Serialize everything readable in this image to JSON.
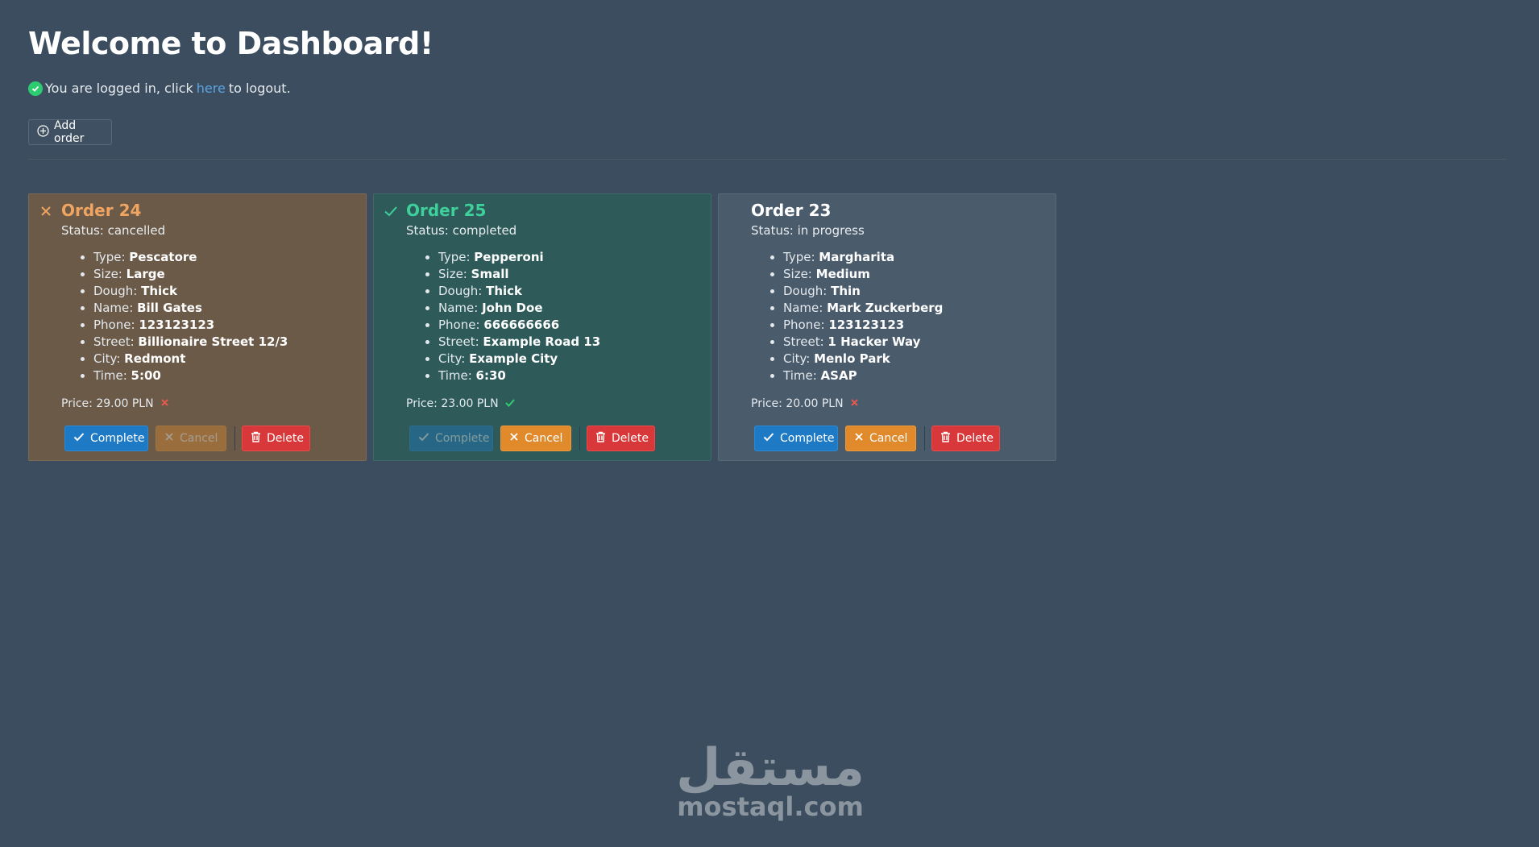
{
  "page": {
    "title": "Welcome to Dashboard!"
  },
  "login": {
    "prefix": "You are logged in, click",
    "link": "here",
    "suffix": "to logout."
  },
  "toolbar": {
    "add_label": "Add order"
  },
  "orders": [
    {
      "title": "Order 24",
      "status": "Status: cancelled",
      "fields": [
        {
          "label": "Type:",
          "value": "Pescatore"
        },
        {
          "label": "Size:",
          "value": "Large"
        },
        {
          "label": "Dough:",
          "value": "Thick"
        },
        {
          "label": "Name:",
          "value": "Bill Gates"
        },
        {
          "label": "Phone:",
          "value": "123123123"
        },
        {
          "label": "Street:",
          "value": "Billionaire Street 12/3"
        },
        {
          "label": "City:",
          "value": "Redmont"
        },
        {
          "label": "Time:",
          "value": "5:00"
        }
      ],
      "price": "Price: 29.00 PLN",
      "buttons": {
        "complete": "Complete",
        "cancel": "Cancel",
        "delete": "Delete"
      }
    },
    {
      "title": "Order 25",
      "status": "Status: completed",
      "fields": [
        {
          "label": "Type:",
          "value": "Pepperoni"
        },
        {
          "label": "Size:",
          "value": "Small"
        },
        {
          "label": "Dough:",
          "value": "Thick"
        },
        {
          "label": "Name:",
          "value": "John Doe"
        },
        {
          "label": "Phone:",
          "value": "666666666"
        },
        {
          "label": "Street:",
          "value": "Example Road 13"
        },
        {
          "label": "City:",
          "value": "Example City"
        },
        {
          "label": "Time:",
          "value": "6:30"
        }
      ],
      "price": "Price: 23.00 PLN",
      "buttons": {
        "complete": "Complete",
        "cancel": "Cancel",
        "delete": "Delete"
      }
    },
    {
      "title": "Order 23",
      "status": "Status: in progress",
      "fields": [
        {
          "label": "Type:",
          "value": "Margharita"
        },
        {
          "label": "Size:",
          "value": "Medium"
        },
        {
          "label": "Dough:",
          "value": "Thin"
        },
        {
          "label": "Name:",
          "value": "Mark Zuckerberg"
        },
        {
          "label": "Phone:",
          "value": "123123123"
        },
        {
          "label": "Street:",
          "value": "1 Hacker Way"
        },
        {
          "label": "City:",
          "value": "Menlo Park"
        },
        {
          "label": "Time:",
          "value": "ASAP"
        }
      ],
      "price": "Price: 20.00 PLN",
      "buttons": {
        "complete": "Complete",
        "cancel": "Cancel",
        "delete": "Delete"
      }
    }
  ],
  "watermark": {
    "arabic": "مستقل",
    "latin": "mostaql.com"
  },
  "colors": {
    "background": "#3b4d5e",
    "cancelled_card": "#6b5a48",
    "completed_card": "#2e5b5a",
    "progress_card": "#4a5b6c",
    "complete_button": "#1f7ac6",
    "cancel_button": "#e08a2c",
    "delete_button": "#d9383a"
  }
}
